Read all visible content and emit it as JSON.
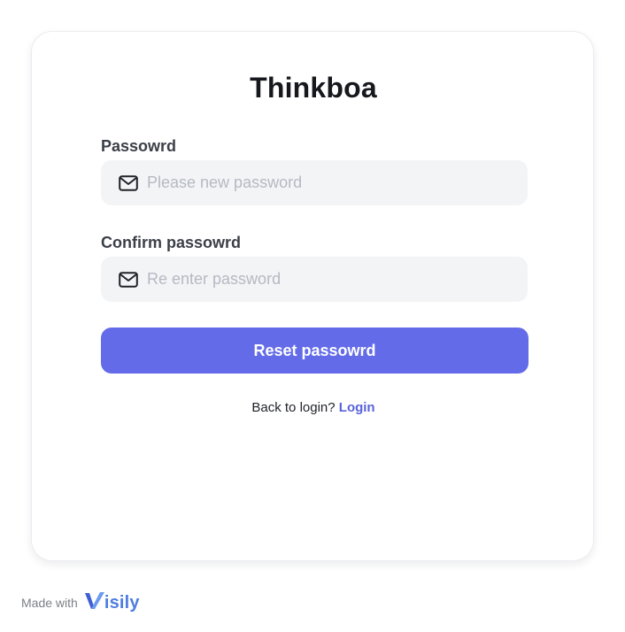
{
  "app": {
    "title": "Thinkboa"
  },
  "form": {
    "password": {
      "label": "Passowrd",
      "placeholder": "Please new password",
      "value": "",
      "icon": "mail-icon"
    },
    "confirm_password": {
      "label": "Confirm passowrd",
      "placeholder": "Re enter password",
      "value": "",
      "icon": "mail-icon"
    },
    "submit_label": "Reset passowrd"
  },
  "footer_link": {
    "prompt": "Back to login?",
    "link_label": "Login"
  },
  "branding": {
    "made_with": "Made with",
    "logo_text": "isily",
    "logo_icon": "visily-v-icon"
  },
  "colors": {
    "accent": "#636be8",
    "link": "#5a63d9",
    "input_bg": "#f3f4f6",
    "logo": "#4e7de0"
  }
}
